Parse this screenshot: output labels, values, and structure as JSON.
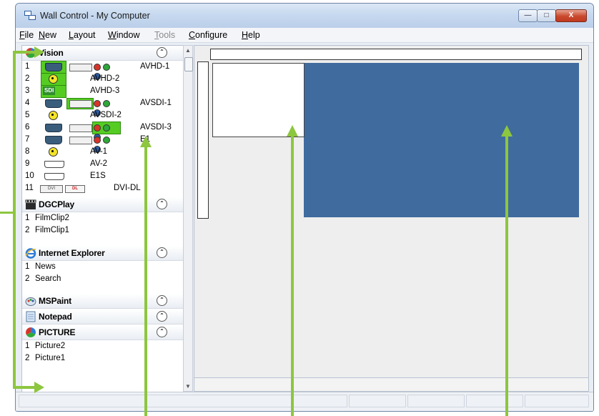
{
  "window": {
    "title": "Wall Control - My Computer"
  },
  "menu": [
    {
      "label": "File",
      "ul": "F",
      "rest": "ile",
      "disabled": false
    },
    {
      "label": "New",
      "ul": "N",
      "rest": "ew",
      "disabled": false
    },
    {
      "label": "Layout",
      "ul": "L",
      "rest": "ayout",
      "disabled": false
    },
    {
      "label": "Window",
      "ul": "W",
      "rest": "indow",
      "disabled": false
    },
    {
      "label": "Tools",
      "ul": "T",
      "rest": "ools",
      "disabled": true
    },
    {
      "label": "Configure",
      "ul": "C",
      "rest": "onfigure",
      "disabled": false
    },
    {
      "label": "Help",
      "ul": "H",
      "rest": "elp",
      "disabled": false
    }
  ],
  "groups": {
    "vision": {
      "name": "Vision",
      "items": [
        {
          "num": "1",
          "label": "AVHD-1"
        },
        {
          "num": "2",
          "label": "AVHD-2"
        },
        {
          "num": "3",
          "label": "AVHD-3"
        },
        {
          "num": "4",
          "label": "AVSDI-1"
        },
        {
          "num": "5",
          "label": "AVSDI-2"
        },
        {
          "num": "6",
          "label": "AVSDI-3"
        },
        {
          "num": "7",
          "label": "E1"
        },
        {
          "num": "8",
          "label": "AV-1"
        },
        {
          "num": "9",
          "label": "AV-2"
        },
        {
          "num": "10",
          "label": "E1S"
        },
        {
          "num": "11",
          "label": "DVI-DL"
        }
      ]
    },
    "dgcplay": {
      "name": "DGCPlay",
      "items": [
        {
          "num": "1",
          "label": "FilmClip2"
        },
        {
          "num": "2",
          "label": "FilmClip1"
        }
      ]
    },
    "ie": {
      "name": "Internet Explorer",
      "items": [
        {
          "num": "1",
          "label": "News"
        },
        {
          "num": "2",
          "label": "Search"
        }
      ]
    },
    "mspaint": {
      "name": "MSPaint",
      "items": []
    },
    "notepad": {
      "name": "Notepad",
      "items": []
    },
    "picture": {
      "name": "PICTURE",
      "items": [
        {
          "num": "1",
          "label": "Picture2"
        },
        {
          "num": "2",
          "label": "Picture1"
        }
      ]
    }
  },
  "icons": {
    "collapse": "chevron-up-double-icon",
    "sdi_text": "SDI",
    "dvi_text": "DVI",
    "dl_text": "DL"
  },
  "colors": {
    "wall_blue": "#3f6b9f",
    "highlight_green": "#55cc22",
    "annotation_green": "#8dc63f"
  }
}
